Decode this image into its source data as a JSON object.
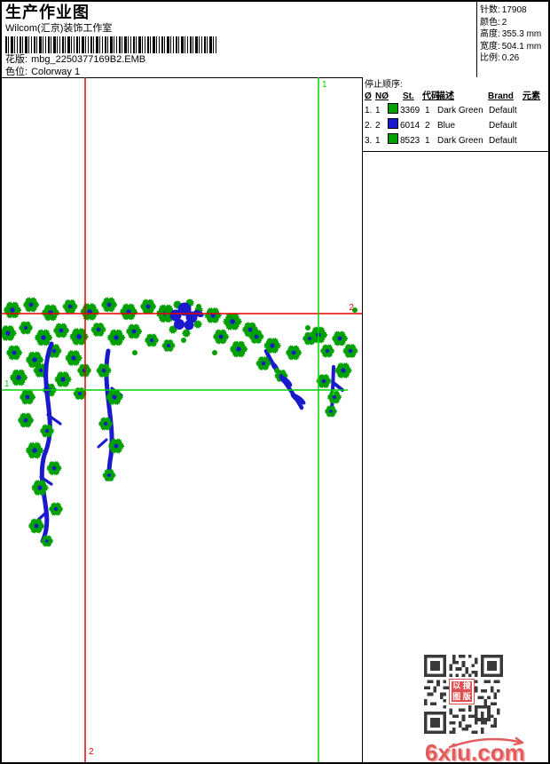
{
  "header": {
    "title": "生产作业图",
    "subtitle": "Wilcom(汇京)装饰工作室",
    "design_label": "花版:",
    "design_value": "mbg_2250377169B2.EMB",
    "colorway_label": "色位:",
    "colorway_value": "Colorway 1"
  },
  "info": {
    "rows": [
      {
        "label": "针数:",
        "value": "17908"
      },
      {
        "label": "颜色:",
        "value": "2"
      },
      {
        "label": "高度:",
        "value": "355.3 mm"
      },
      {
        "label": "宽度:",
        "value": "504.1 mm"
      },
      {
        "label": "比例:",
        "value": "0.26"
      }
    ]
  },
  "stop_sequence": {
    "title": "停止顺序:",
    "columns": [
      "Ø",
      "NØ",
      "St.",
      "代码",
      "描述",
      "Brand",
      "元素"
    ],
    "rows": [
      {
        "index": "1.",
        "needle": "1",
        "swatch": "#00A000",
        "st": "3369",
        "code": "1",
        "desc": "Dark Green",
        "brand": "Default",
        "element": ""
      },
      {
        "index": "2.",
        "needle": "2",
        "swatch": "#1A1ACC",
        "st": "6014",
        "code": "2",
        "desc": "Blue",
        "brand": "Default",
        "element": ""
      },
      {
        "index": "3.",
        "needle": "1",
        "swatch": "#00A000",
        "st": "8523",
        "code": "1",
        "desc": "Dark Green",
        "brand": "Default",
        "element": ""
      }
    ]
  },
  "canvas": {
    "start_label": "1",
    "end_label": "2",
    "colors": {
      "thread_green": "#00A000",
      "thread_blue": "#1A1ACC",
      "marker_red": "#E80000",
      "marker_green": "#00D400"
    }
  },
  "watermark": {
    "site": "6xiu.com",
    "stamp_chars": [
      "以",
      "搜",
      "图",
      "版"
    ]
  }
}
